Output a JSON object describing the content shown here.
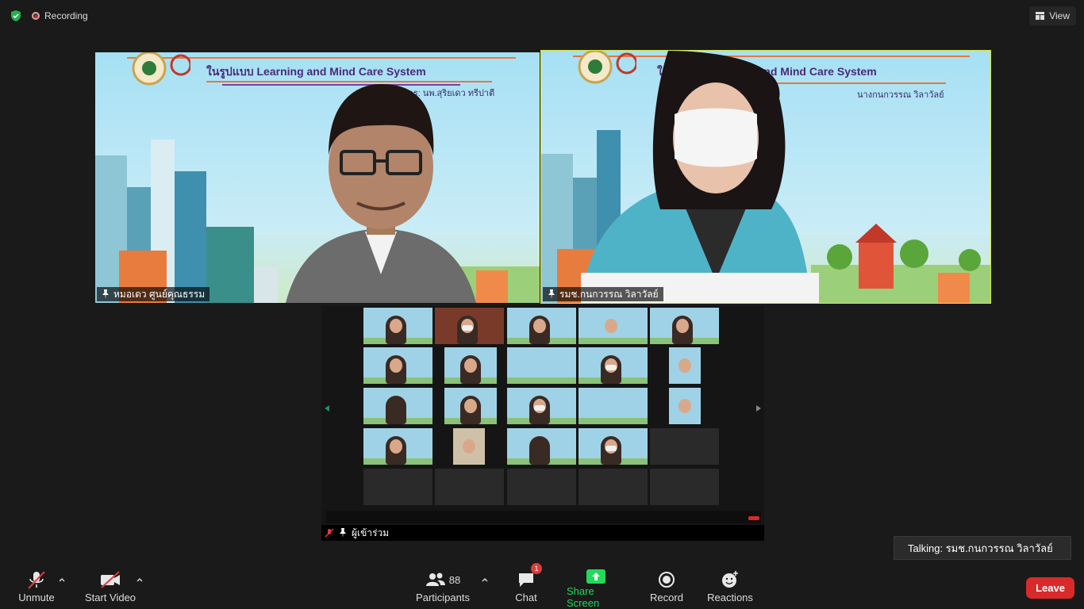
{
  "topbar": {
    "recording_label": "Recording",
    "view_label": "View"
  },
  "videos": [
    {
      "name": "หมอเดว ศูนย์คุณธรรม",
      "banner_title": "ในรูปแบบ Learning and Mind Care System",
      "banner_sub": "วิทยากร: นพ.สุริยเดว ทรีปาตี"
    },
    {
      "name": "รมช.กนกวรรณ วิลาวัลย์",
      "banner_title": "ในรูปแบบ Learning and Mind Care System",
      "banner_sub": "นางกนกวรรณ วิลาวัลย์"
    }
  ],
  "share": {
    "presenter_name": "ผู้เข้าร่วม"
  },
  "talking": {
    "label": "Talking: รมช.กนกวรรณ วิลาวัลย์"
  },
  "toolbar": {
    "unmute": "Unmute",
    "start_video": "Start Video",
    "participants": "Participants",
    "participants_count": "88",
    "chat": "Chat",
    "chat_badge": "1",
    "share_screen": "Share Screen",
    "record": "Record",
    "reactions": "Reactions",
    "leave": "Leave"
  },
  "colors": {
    "share_screen_green": "#23d959",
    "leave_red": "#d92a2a",
    "active_speaker_outline": "#d9e83a"
  }
}
